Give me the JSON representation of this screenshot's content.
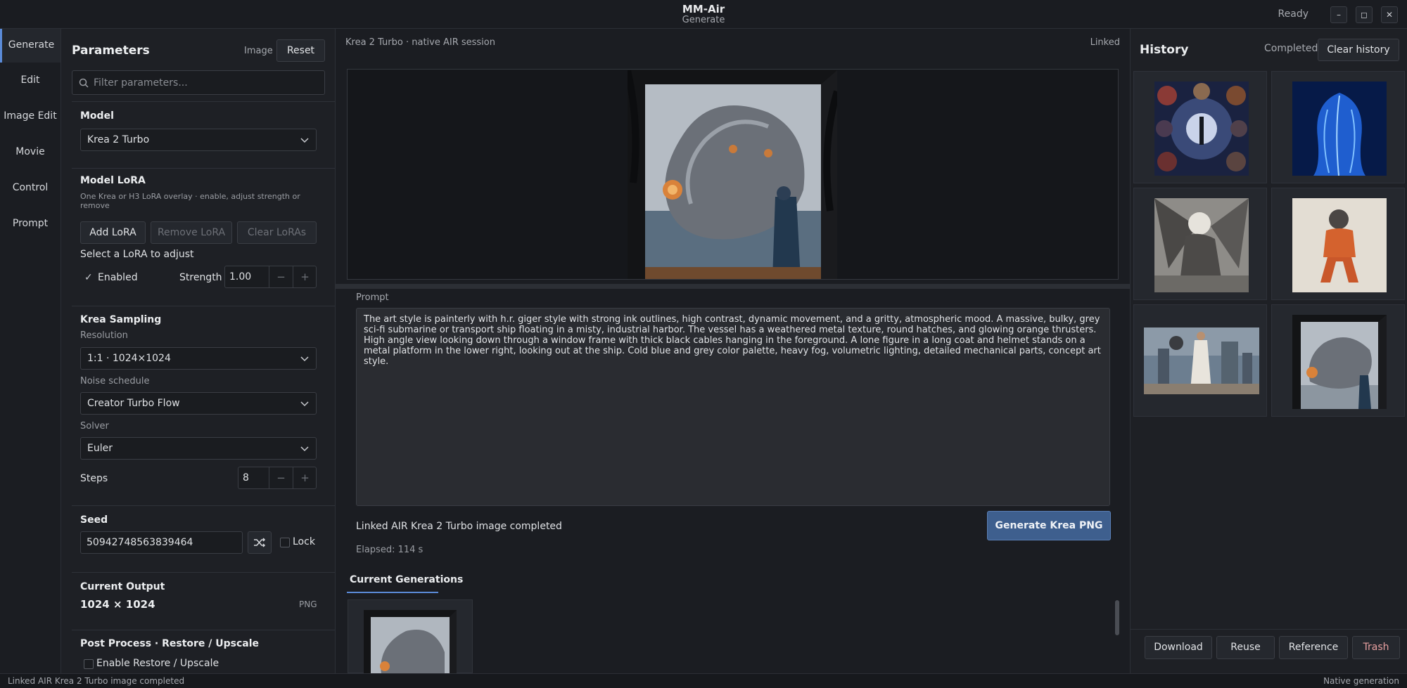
{
  "app": {
    "title": "MM-Air",
    "subtitle": "Generate",
    "status": "Ready"
  },
  "window_controls": {
    "minimize": "–",
    "maximize": "◻",
    "close": "✕"
  },
  "nav": {
    "items": [
      "Generate",
      "Edit",
      "Image Edit",
      "Movie",
      "Control",
      "Prompt"
    ],
    "active": "Generate"
  },
  "params": {
    "title": "Parameters",
    "image_label": "Image",
    "reset_label": "Reset",
    "filter_placeholder": "Filter parameters...",
    "model": {
      "title": "Model",
      "value": "Krea 2 Turbo"
    },
    "lora": {
      "title": "Model LoRA",
      "help": "One Krea or H3 LoRA overlay · enable, adjust strength or remove",
      "add": "Add LoRA",
      "remove": "Remove LoRA",
      "clear": "Clear LoRAs",
      "select_hint": "Select a LoRA to adjust",
      "enabled_label": "Enabled",
      "strength_label": "Strength",
      "strength_value": "1.00"
    },
    "sampling": {
      "title": "Krea Sampling",
      "resolution_label": "Resolution",
      "resolution_value": "1:1 · 1024×1024",
      "noise_label": "Noise schedule",
      "noise_value": "Creator Turbo Flow",
      "solver_label": "Solver",
      "solver_value": "Euler",
      "steps_label": "Steps",
      "steps_value": "8"
    },
    "seed": {
      "title": "Seed",
      "value": "50942748563839464",
      "lock_label": "Lock"
    },
    "output": {
      "title": "Current Output",
      "size": "1024 × 1024",
      "format": "PNG"
    },
    "post": {
      "title": "Post Process · Restore / Upscale",
      "enable_label": "Enable Restore / Upscale"
    }
  },
  "center": {
    "session": "Krea 2 Turbo · native AIR session",
    "linked": "Linked",
    "prompt_label": "Prompt",
    "prompt_text": "The art style is painterly with h.r. giger style with strong ink outlines, high contrast, dynamic movement, and a gritty, atmospheric mood. A massive, bulky, grey sci-fi submarine or transport ship floating in a misty, industrial harbor. The vessel has a weathered metal texture, round hatches, and glowing orange thrusters. High angle view looking down through a window frame with thick black cables hanging in the foreground. A lone figure in a long coat and helmet stands on a metal platform in the lower right, looking out at the ship. Cold blue and grey color palette, heavy fog, volumetric lighting, detailed mechanical parts, concept art style.",
    "status": "Linked AIR Krea 2 Turbo image completed",
    "elapsed": "Elapsed: 114 s",
    "generate_label": "Generate Krea PNG",
    "tab_label": "Current Generations"
  },
  "history": {
    "title": "History",
    "completed": "Completed",
    "clear_label": "Clear history",
    "thumbs": [
      "faces-collage",
      "blue-hair-figure",
      "winged-warrior",
      "clay-figure",
      "city-figure",
      "airship-window"
    ],
    "actions": {
      "download": "Download",
      "reuse": "Reuse",
      "reference": "Reference",
      "trash": "Trash"
    }
  },
  "statusbar": {
    "left": "Linked AIR Krea 2 Turbo image completed",
    "right": "Native generation"
  },
  "colors": {
    "accent": "#5b8bd8",
    "generate_button": "#3e5f8e",
    "trash_text": "#e8a0a0"
  }
}
